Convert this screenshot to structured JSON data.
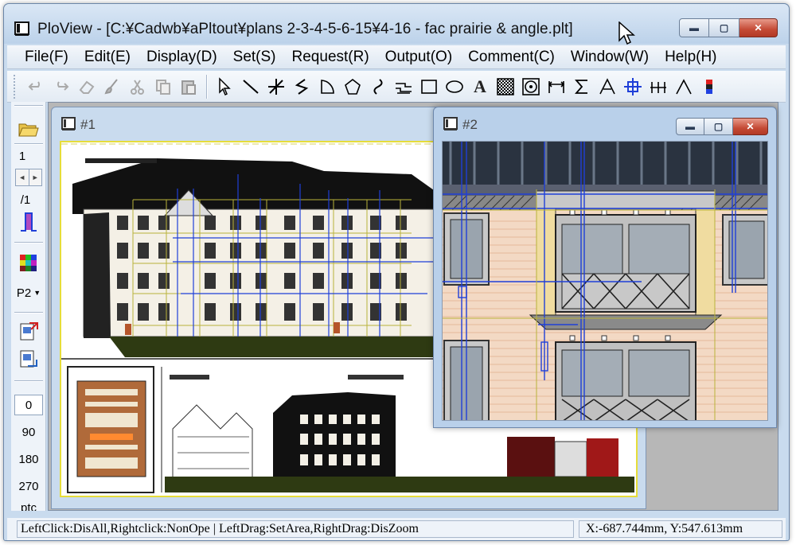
{
  "window": {
    "title": "PloView - [C:¥Cadwb¥aPltout¥plans 2-3-4-5-6-15¥4-16 - fac prairie & angle.plt]",
    "min_label": "▬",
    "max_label": "▢",
    "close_label": "✕"
  },
  "menu": [
    "File(F)",
    "Edit(E)",
    "Display(D)",
    "Set(S)",
    "Request(R)",
    "Output(O)",
    "Comment(C)",
    "Window(W)",
    "Help(H)"
  ],
  "toolbar": {
    "icons": [
      "undo-icon",
      "redo-icon",
      "eraser-icon",
      "brush-icon",
      "cut-icon",
      "copy-icon",
      "paste-icon",
      "select-arrow-icon",
      "line-icon",
      "cross-lines-icon",
      "polyline-icon",
      "sector-icon",
      "pentagon-icon",
      "curve-icon",
      "stair-line-icon",
      "rectangle-icon",
      "ellipse-icon",
      "text-icon",
      "hatch-icon",
      "circle-target-icon",
      "dimension-icon",
      "sigma-icon",
      "angle-icon",
      "crosshair-icon",
      "multi-dim-icon",
      "angle-dim-icon",
      "color-bar-icon"
    ],
    "text_tool_label": "A"
  },
  "sidebar": {
    "page_number": "1",
    "page_total": "/1",
    "pen_label": "P2",
    "angles": [
      "0",
      "90",
      "180",
      "270"
    ],
    "more_label": "ptc"
  },
  "child1": {
    "title": "#1"
  },
  "child2": {
    "title": "#2"
  },
  "status": {
    "hint": "LeftClick:DisAll,Rightclick:NonOpe   |   LeftDrag:SetArea,RightDrag:DisZoom",
    "coords": "X:-687.744mm, Y:547.613mm"
  },
  "colors": {
    "frame": "#c9dbee",
    "close_red": "#c44a35",
    "drawing_border": "#e6dd3a",
    "dimension_blue": "#1f3fd8",
    "grid_yellow": "#b9b23a",
    "ground_green": "#2e3a12"
  }
}
